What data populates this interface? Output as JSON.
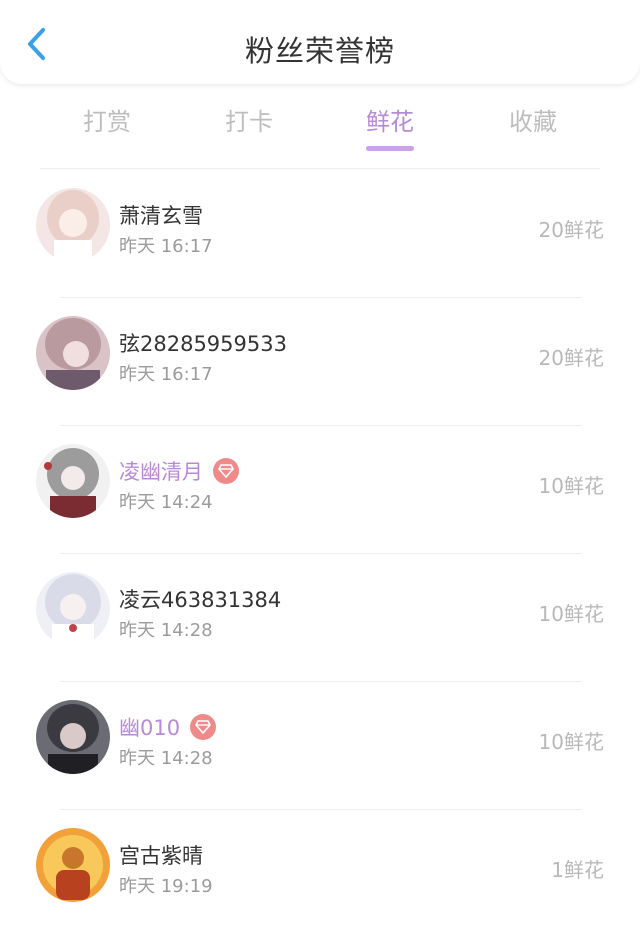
{
  "header": {
    "title": "粉丝荣誉榜",
    "back_icon": "chevron-left-icon"
  },
  "tabs": [
    {
      "label": "打赏",
      "active": false
    },
    {
      "label": "打卡",
      "active": false
    },
    {
      "label": "鲜花",
      "active": true
    },
    {
      "label": "收藏",
      "active": false
    }
  ],
  "colors": {
    "accent": "#b78ad6",
    "back": "#3aa0e6",
    "vip_badge": "#f08a8a"
  },
  "fans": [
    {
      "name": "萧清玄雪",
      "time": "昨天 16:17",
      "amount": "20鲜花",
      "vip": false
    },
    {
      "name": "弦28285959533",
      "time": "昨天 16:17",
      "amount": "20鲜花",
      "vip": false
    },
    {
      "name": "凌幽清月",
      "time": "昨天 14:24",
      "amount": "10鲜花",
      "vip": true
    },
    {
      "name": "凌云463831384",
      "time": "昨天 14:28",
      "amount": "10鲜花",
      "vip": false
    },
    {
      "name": "幽010",
      "time": "昨天 14:28",
      "amount": "10鲜花",
      "vip": true
    },
    {
      "name": "宫古紫晴",
      "time": "昨天 19:19",
      "amount": "1鲜花",
      "vip": false
    }
  ]
}
